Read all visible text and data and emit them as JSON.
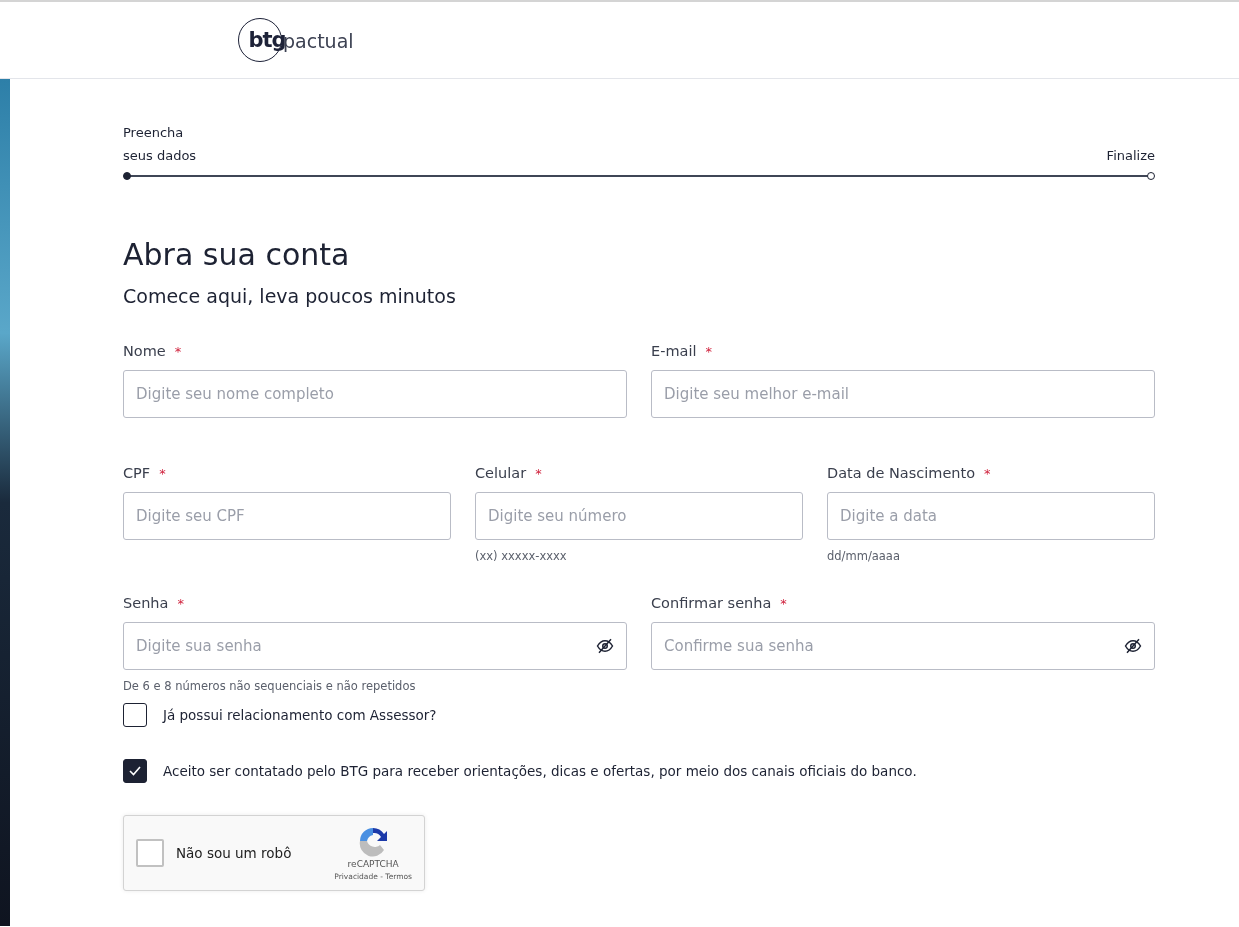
{
  "header": {
    "logo": {
      "mark": "btg",
      "word": "pactual"
    }
  },
  "stepper": {
    "level": 1,
    "steps": [
      {
        "label": "Preencha seus dados",
        "selected": true
      },
      {
        "label": "Finalize",
        "selected": false
      }
    ]
  },
  "title": "Abra sua conta",
  "subtitle": "Comece aqui, leva poucos minutos",
  "form_rows": [
    [
      {
        "label": "Nome",
        "required_mark": "*",
        "placeholder": "Digite seu nome completo",
        "kind": "text"
      },
      {
        "label": "E-mail",
        "required_mark": "*",
        "placeholder": "Digite seu melhor e-mail",
        "kind": "text"
      }
    ],
    [
      {
        "label": "CPF",
        "required_mark": "*",
        "placeholder": "Digite seu CPF",
        "kind": "text"
      },
      {
        "label": "Celular",
        "required_mark": "*",
        "placeholder": "Digite seu número",
        "hint": "(xx) xxxxx-xxxx",
        "kind": "text"
      },
      {
        "label": "Data de Nascimento",
        "required_mark": "*",
        "placeholder": "Digite a data",
        "hint": "dd/mm/aaaa",
        "kind": "text"
      }
    ],
    [
      {
        "label": "Senha",
        "required_mark": "*",
        "placeholder": "Digite sua senha",
        "hint": "De 6 e 8 números não sequenciais e não repetidos",
        "kind": "password"
      },
      {
        "label": "Confirmar senha",
        "required_mark": "*",
        "placeholder": "Confirme sua senha",
        "kind": "password"
      }
    ]
  ],
  "checkboxes": [
    {
      "label": "Já possui relacionamento com Assessor?",
      "checked": false
    },
    {
      "label": "Aceito ser contatado pelo BTG para receber orientações, dicas e ofertas, por meio dos canais oficiais do banco.",
      "checked": true
    }
  ],
  "captcha": {
    "label": "Não sou um robô",
    "checked": false,
    "brand": "reCAPTCHA",
    "links": "Privacidade - Termos"
  }
}
